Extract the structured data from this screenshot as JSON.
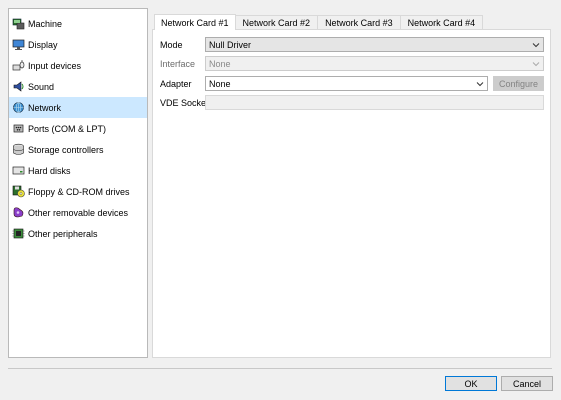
{
  "sidebar": {
    "items": [
      {
        "label": "Machine",
        "icon": "machine-icon"
      },
      {
        "label": "Display",
        "icon": "display-icon"
      },
      {
        "label": "Input devices",
        "icon": "input-devices-icon"
      },
      {
        "label": "Sound",
        "icon": "sound-icon"
      },
      {
        "label": "Network",
        "icon": "network-icon"
      },
      {
        "label": "Ports (COM & LPT)",
        "icon": "ports-icon"
      },
      {
        "label": "Storage controllers",
        "icon": "storage-icon"
      },
      {
        "label": "Hard disks",
        "icon": "hard-disk-icon"
      },
      {
        "label": "Floppy & CD-ROM drives",
        "icon": "floppy-cdrom-icon"
      },
      {
        "label": "Other removable devices",
        "icon": "removable-devices-icon"
      },
      {
        "label": "Other peripherals",
        "icon": "peripherals-icon"
      }
    ],
    "selected": "Network"
  },
  "tabs": [
    "Network Card #1",
    "Network Card #2",
    "Network Card #3",
    "Network Card #4"
  ],
  "form": {
    "mode_label": "Mode",
    "mode_value": "Null Driver",
    "interface_label": "Interface",
    "interface_value": "None",
    "adapter_label": "Adapter",
    "adapter_value": "None",
    "configure_label": "Configure",
    "vde_label": "VDE Socket",
    "vde_value": ""
  },
  "footer": {
    "ok_label": "OK",
    "cancel_label": "Cancel"
  },
  "colors": {
    "selection": "#cce8ff",
    "accent": "#0078d7"
  }
}
